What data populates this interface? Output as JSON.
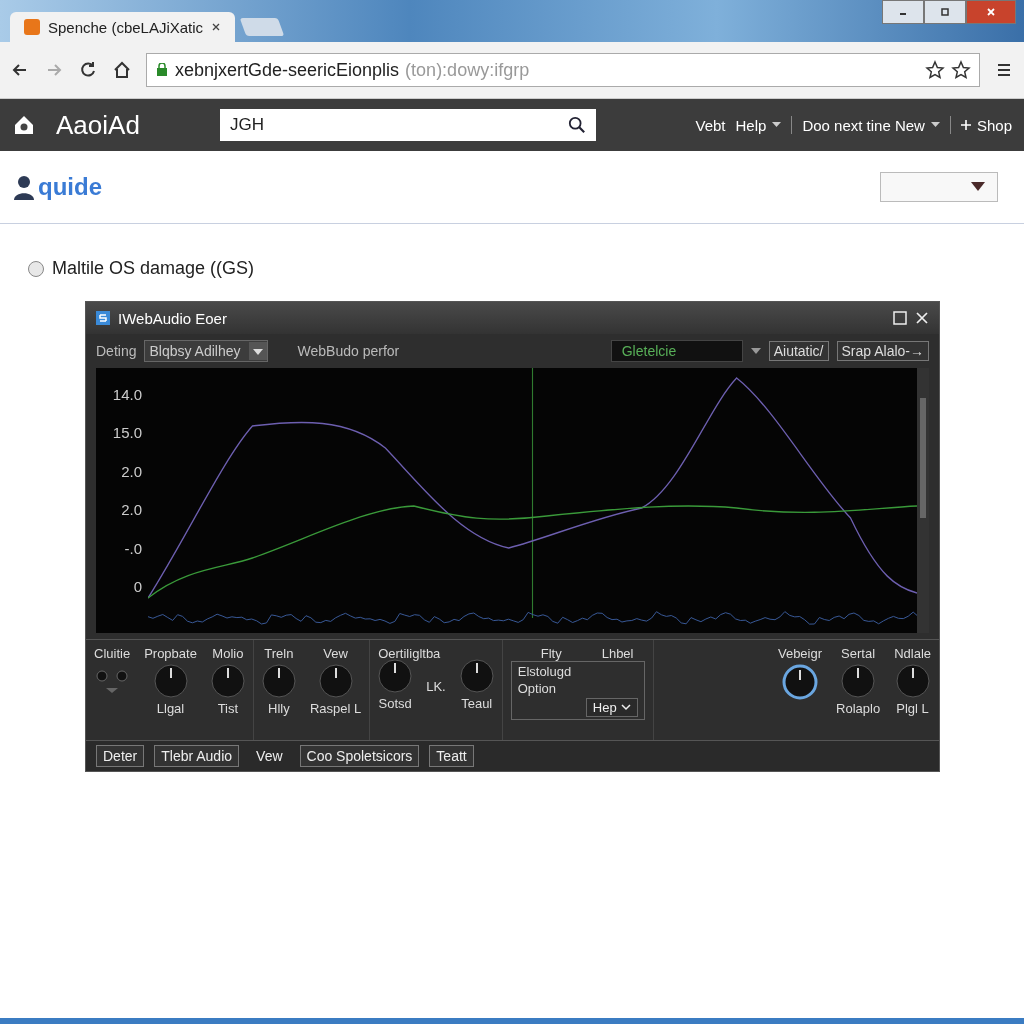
{
  "browser": {
    "tab": {
      "title": "Spenche (cbeLAJiXatic"
    },
    "url": {
      "host": "xebnjxertGde-seericEionplis",
      "rest": "(ton):dowy:ifgrp"
    }
  },
  "site_nav": {
    "logo": "AaoiAd",
    "search": {
      "value": "JGH"
    },
    "items": [
      {
        "label": "Vebt",
        "dropdown": false,
        "plus": false
      },
      {
        "label": "Help",
        "dropdown": true,
        "plus": false
      },
      {
        "label": "Doo next tine New",
        "dropdown": true,
        "plus": false
      },
      {
        "label": "Shop",
        "dropdown": false,
        "plus": true
      }
    ]
  },
  "header": {
    "logo": "quide"
  },
  "option": {
    "label": "Maltile OS damage ((GS)",
    "checked": false
  },
  "plugin": {
    "title": "IWebAudio Eoer",
    "toolbar": {
      "label": "Deting",
      "select": "Blqbsy Adilhey",
      "text": "WebBudo perfor",
      "field": "Gletelcie",
      "buttons": [
        "Aiutatic/",
        "Srap Alalo-→"
      ]
    },
    "axis_labels": [
      "14.0",
      "15.0",
      "2.0",
      "2.0",
      "-.0",
      "0"
    ],
    "sections": [
      {
        "kind": "knobs",
        "items": [
          {
            "label": "Cluitie",
            "kind": "dots"
          },
          {
            "label": "Propbate",
            "kind": "knob",
            "sublabel": "Llgal"
          },
          {
            "label": "Molio",
            "kind": "knob",
            "sublabel": "Tist"
          }
        ]
      },
      {
        "kind": "knobs",
        "items": [
          {
            "label": "Treln",
            "kind": "knob",
            "sublabel": "Hlly"
          },
          {
            "label": "Vew",
            "kind": "knob",
            "sublabel": "Raspel L"
          }
        ]
      },
      {
        "kind": "knobs",
        "title": "Oertiligltba",
        "items": [
          {
            "kind": "knob",
            "sublabel": "Sotsd"
          },
          {
            "label": "LK.",
            "kind": "text"
          },
          {
            "kind": "knob",
            "sublabel": "Teaul"
          }
        ]
      },
      {
        "kind": "panel",
        "labels": [
          "Flty",
          "Lhbel"
        ],
        "rows": [
          "Elstolugd",
          "Option"
        ],
        "button": "Hep"
      },
      {
        "kind": "knobs",
        "items": [
          {
            "label": "Vebeigr",
            "kind": "ring"
          },
          {
            "label": "Sertal",
            "kind": "knob",
            "sublabel": "Rolaplo"
          },
          {
            "label": "Ndlale",
            "kind": "knob",
            "sublabel": "Plgl L"
          }
        ]
      }
    ],
    "tabs": [
      {
        "label": "Deter",
        "selected": false
      },
      {
        "label": "Tlebr Audio",
        "selected": false
      },
      {
        "label": "Vew",
        "selected": true
      },
      {
        "label": "Coo Spoletsicors",
        "selected": false
      },
      {
        "label": "Teatt",
        "selected": false
      }
    ]
  }
}
